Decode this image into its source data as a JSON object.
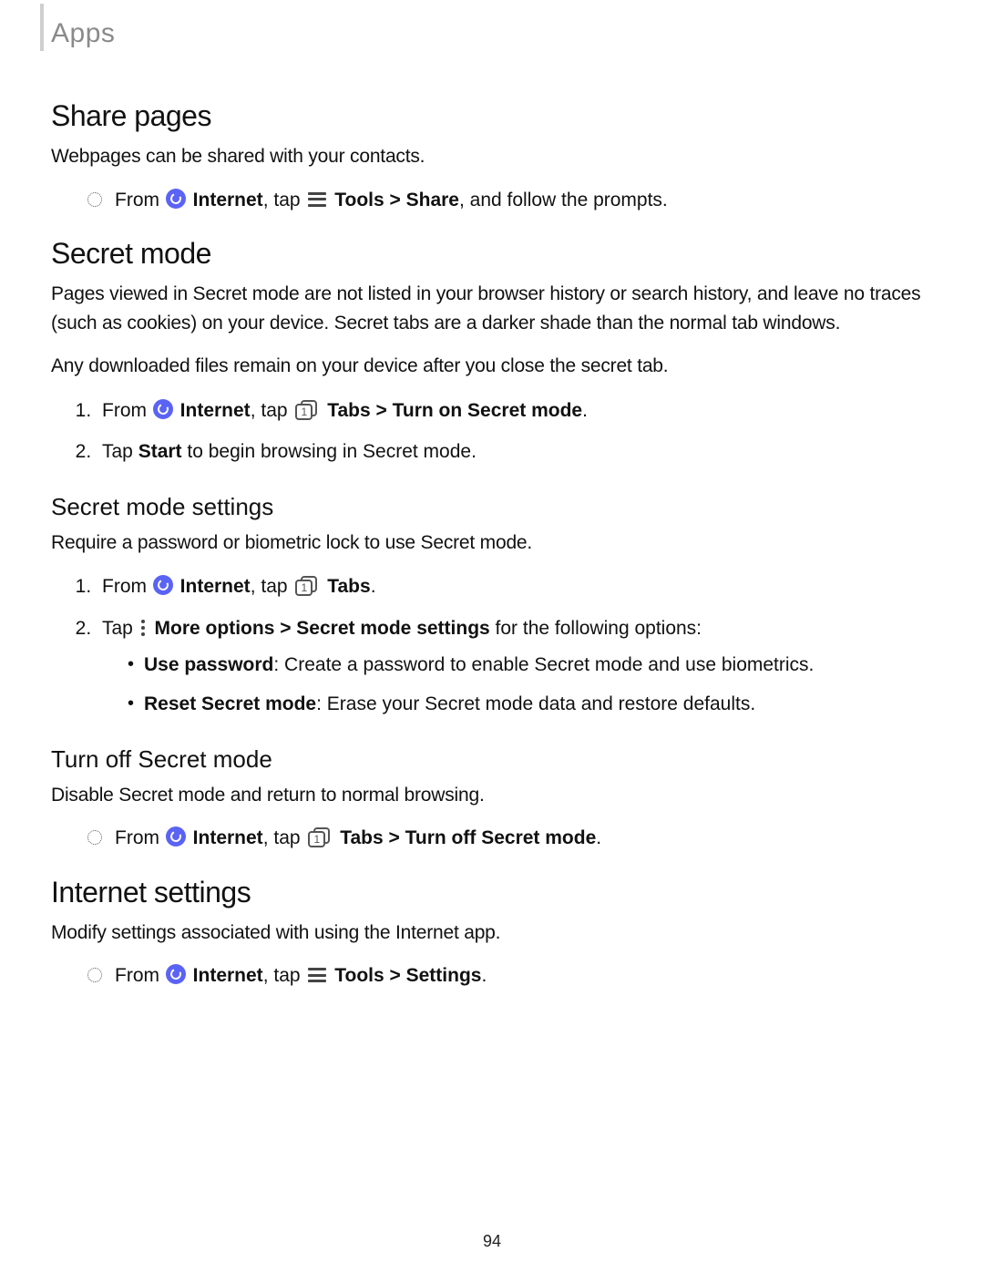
{
  "breadcrumb": "Apps",
  "page_number": "94",
  "share_pages": {
    "heading": "Share pages",
    "intro": "Webpages can be shared with your contacts.",
    "step_from": "From ",
    "app": "Internet",
    "tap": ", tap ",
    "path_bold": "Tools > Share",
    "tail": ", and follow the prompts."
  },
  "secret_mode": {
    "heading": "Secret mode",
    "p1": "Pages viewed in Secret mode are not listed in your browser history or search history, and leave no traces (such as cookies) on your device. Secret tabs are a darker shade than the normal tab windows.",
    "p2": "Any downloaded files remain on your device after you close the secret tab.",
    "step1": {
      "from": "From ",
      "app": "Internet",
      "tap": ", tap ",
      "path_bold": "Tabs > Turn on Secret mode",
      "end": "."
    },
    "step2": {
      "pre": "Tap ",
      "bold": "Start",
      "post": " to begin browsing in Secret mode."
    }
  },
  "secret_settings": {
    "heading": "Secret mode settings",
    "intro": "Require a password or biometric lock to use Secret mode.",
    "step1": {
      "from": "From ",
      "app": "Internet",
      "tap": ", tap ",
      "path_bold": "Tabs",
      "end": "."
    },
    "step2": {
      "pre": "Tap ",
      "path_bold": "More options > Secret mode settings",
      "post": " for the following options:"
    },
    "opt1": {
      "bold": "Use password",
      "rest": ": Create a password to enable Secret mode and use biometrics."
    },
    "opt2": {
      "bold": "Reset Secret mode",
      "rest": ": Erase your Secret mode data and restore defaults."
    }
  },
  "turn_off": {
    "heading": "Turn off Secret mode",
    "intro": "Disable Secret mode and return to normal browsing.",
    "step": {
      "from": "From ",
      "app": "Internet",
      "tap": ", tap ",
      "path_bold": "Tabs > Turn off Secret mode",
      "end": "."
    }
  },
  "internet_settings": {
    "heading": "Internet settings",
    "intro": "Modify settings associated with using the Internet app.",
    "step": {
      "from": "From ",
      "app": "Internet",
      "tap": ", tap ",
      "path_bold": "Tools > Settings",
      "end": "."
    }
  }
}
